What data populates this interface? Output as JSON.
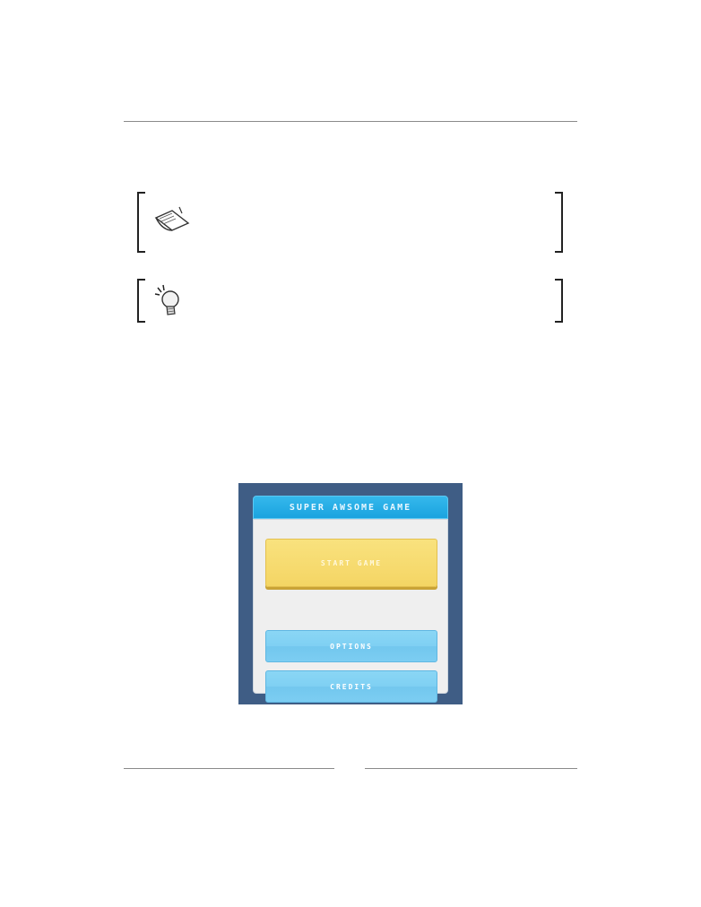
{
  "note": {
    "icon": "note-paper-icon"
  },
  "tip": {
    "icon": "lightbulb-icon"
  },
  "game_menu": {
    "title": "SUPER AWSOME GAME",
    "buttons": {
      "start": "START GAME",
      "options": "OPTIONS",
      "credits": "CREDITS"
    },
    "colors": {
      "frame": "#3f5d85",
      "title_bar": "#1aa3df",
      "panel": "#efefef",
      "start_button": "#f4d564",
      "menu_button": "#7fd0f3"
    }
  }
}
